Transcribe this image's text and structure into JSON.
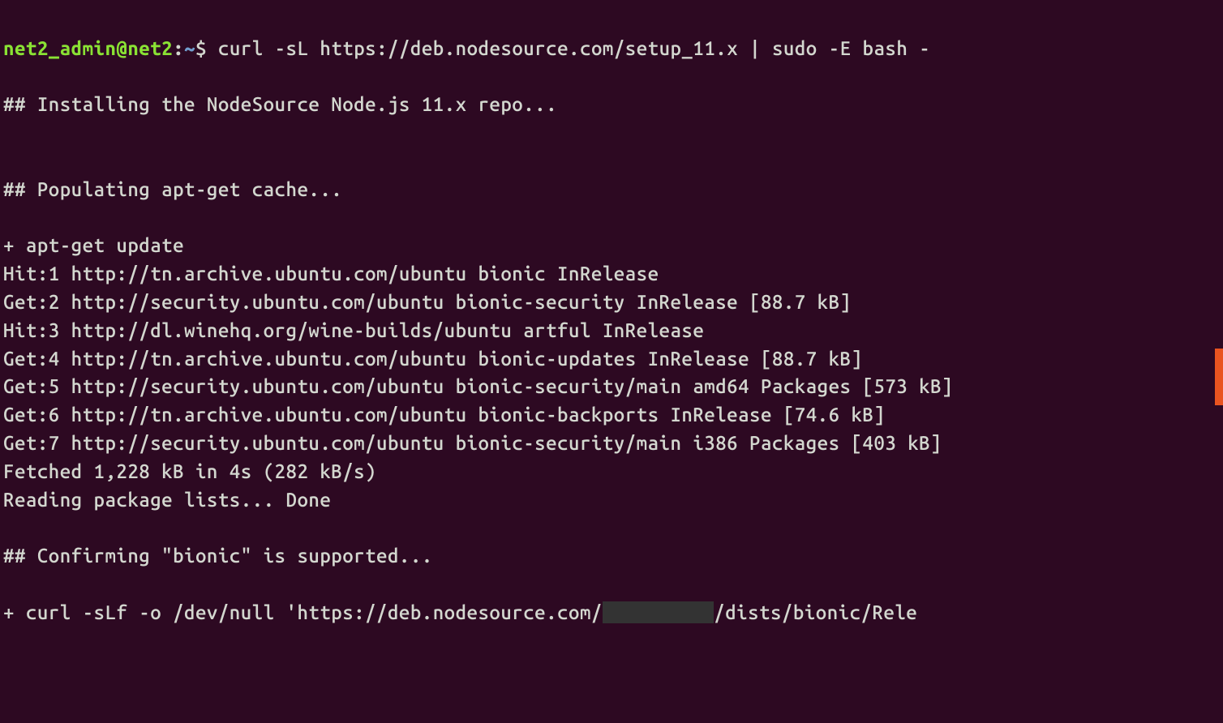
{
  "prompt": {
    "user_host": "net2_admin@net2",
    "separator": ":",
    "path": "~",
    "dollar": "$"
  },
  "command": "curl -sL https://deb.nodesource.com/setup_11.x | sudo -E bash -",
  "output": {
    "l1": "",
    "l2": "## Installing the NodeSource Node.js 11.x repo...",
    "l3": "",
    "l4": "",
    "l5": "## Populating apt-get cache...",
    "l6": "",
    "l7": "+ apt-get update",
    "l8": "Hit:1 http://tn.archive.ubuntu.com/ubuntu bionic InRelease",
    "l9": "Get:2 http://security.ubuntu.com/ubuntu bionic-security InRelease [88.7 kB]",
    "l10": "Hit:3 http://dl.winehq.org/wine-builds/ubuntu artful InRelease",
    "l11": "Get:4 http://tn.archive.ubuntu.com/ubuntu bionic-updates InRelease [88.7 kB]",
    "l12": "Get:5 http://security.ubuntu.com/ubuntu bionic-security/main amd64 Packages [573 kB]",
    "l13": "Get:6 http://tn.archive.ubuntu.com/ubuntu bionic-backports InRelease [74.6 kB]",
    "l14": "Get:7 http://security.ubuntu.com/ubuntu bionic-security/main i386 Packages [403 kB]",
    "l15": "Fetched 1,228 kB in 4s (282 kB/s)",
    "l16": "Reading package lists... Done",
    "l17": "",
    "l18": "## Confirming \"bionic\" is supported...",
    "l19": "",
    "l20": "+ curl -sLf -o /dev/null 'https://deb.nodesource.com/",
    "l20b": "/dists/bionic/Rele"
  }
}
